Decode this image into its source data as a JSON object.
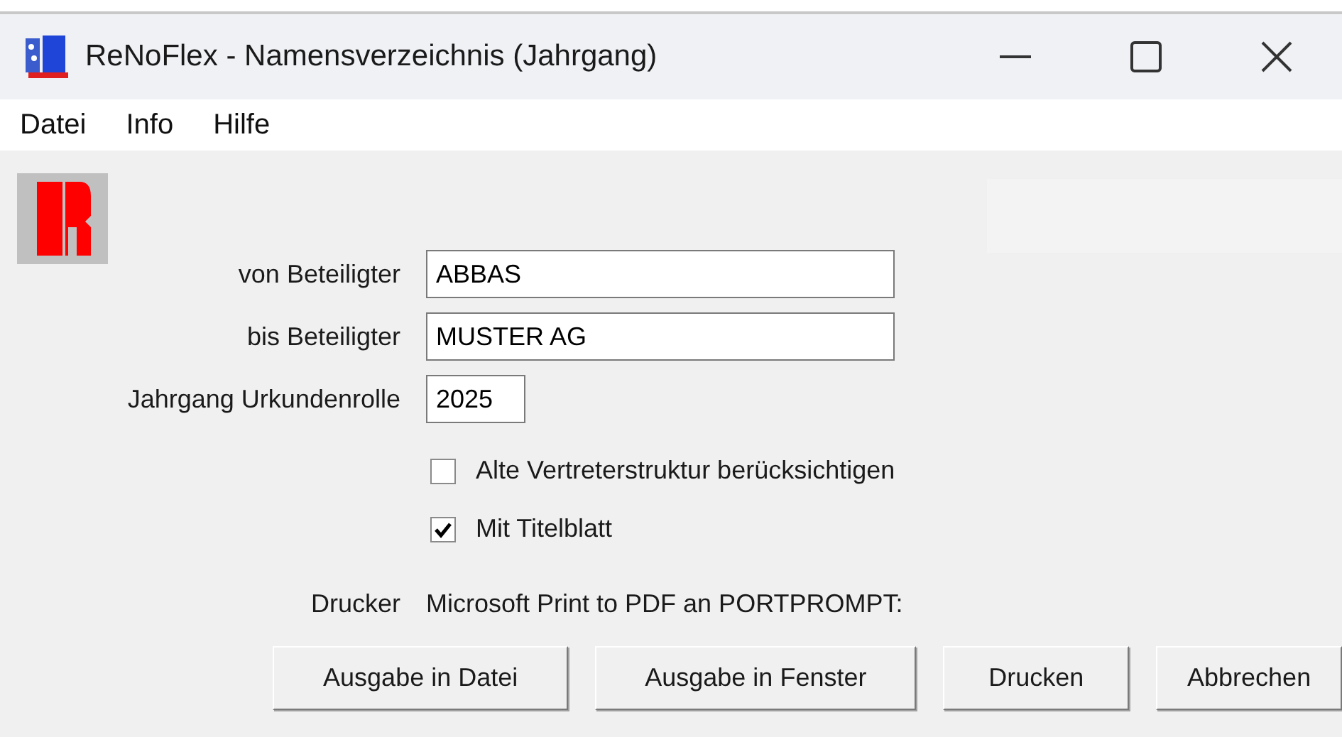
{
  "window": {
    "title": "ReNoFlex - Namensverzeichnis (Jahrgang)"
  },
  "menu": [
    "Datei",
    "Info",
    "Hilfe"
  ],
  "fields": [
    {
      "label": "von Beteiligter",
      "value": "ABBAS",
      "kind": "wide"
    },
    {
      "label": "bis Beteiligter",
      "value": "MUSTER AG",
      "kind": "wide"
    },
    {
      "label": "Jahrgang Urkundenrolle",
      "value": "2025",
      "kind": "short"
    }
  ],
  "checkboxes": [
    {
      "label": "Alte Vertreterstruktur berücksichtigen",
      "checked": false
    },
    {
      "label": "Mit Titelblatt",
      "checked": true
    }
  ],
  "printer": {
    "label": "Drucker",
    "value": "Microsoft Print to PDF an PORTPROMPT:"
  },
  "buttons": [
    "Ausgabe in Datei",
    "Ausgabe in Fenster",
    "Drucken",
    "Abbrechen"
  ]
}
